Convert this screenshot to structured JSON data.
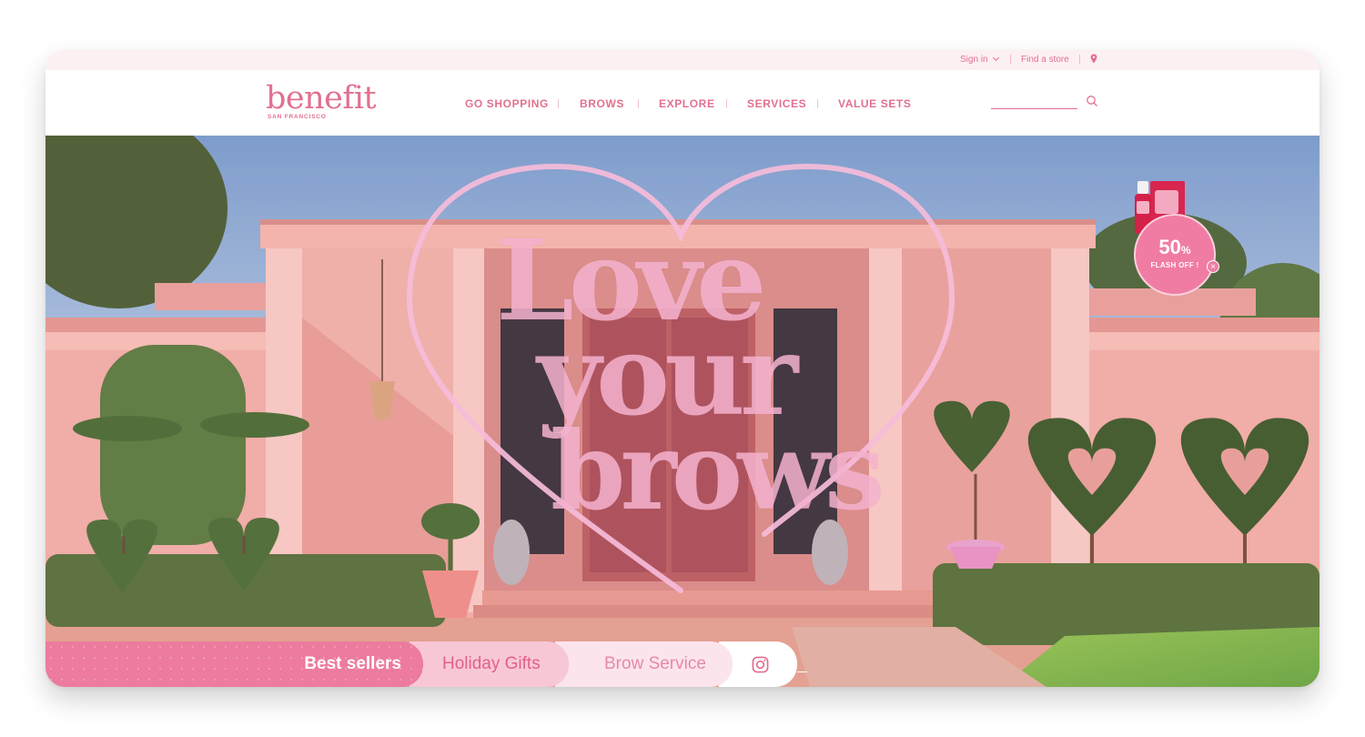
{
  "utility_bar": {
    "sign_in": "Sign in",
    "find_store": "Find a store",
    "location_icon": "location-pin-icon"
  },
  "header": {
    "logo_word": "benefit",
    "logo_sub": "SAN FRANCISCO",
    "nav": [
      {
        "label": "GO SHOPPING"
      },
      {
        "label": "BROWS"
      },
      {
        "label": "EXPLORE"
      },
      {
        "label": "SERVICES"
      },
      {
        "label": "VALUE SETS"
      }
    ],
    "search_placeholder": "",
    "search_icon": "search-icon"
  },
  "hero": {
    "heading_lines": [
      "Love",
      "your",
      "brows"
    ],
    "flash": {
      "percent": "50",
      "percent_sign": "%",
      "label": "FLASH OFF !",
      "close": "×"
    }
  },
  "tabs": [
    {
      "label": "Best sellers"
    },
    {
      "label": "Holiday Gifts"
    },
    {
      "label": "Brow Service"
    }
  ],
  "colors": {
    "brand_pink": "#e2708f",
    "tab_best": "#ec7b9e",
    "tab_holiday": "#f8c7d6",
    "tab_brow": "#fce4ec"
  }
}
